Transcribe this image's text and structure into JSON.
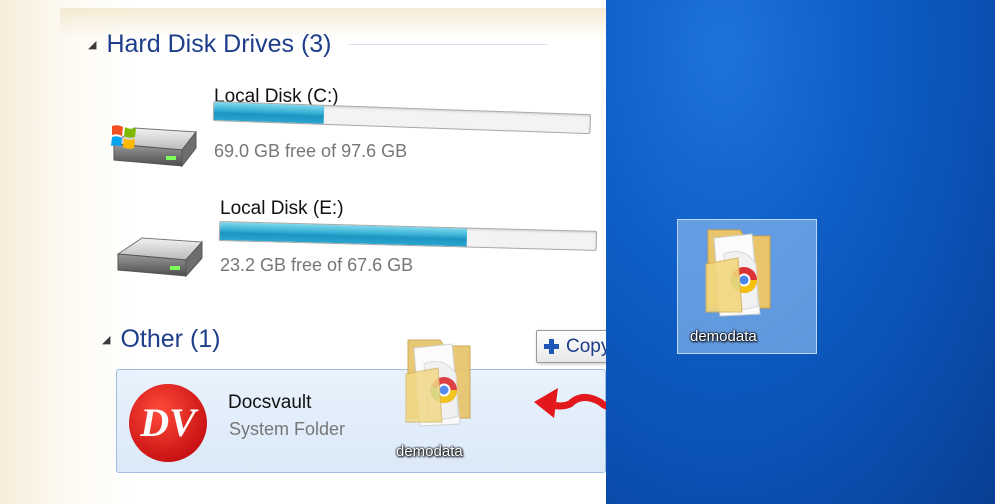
{
  "explorer": {
    "hard_disk_group": {
      "title": "Hard Disk Drives (3)"
    },
    "drives": [
      {
        "name": "Local Disk (C:)",
        "free_text": "69.0 GB free of 97.6 GB",
        "used_fraction": 0.293
      },
      {
        "name": "Local Disk (E:)",
        "free_text": "23.2 GB free of 67.6 GB",
        "used_fraction": 0.657
      }
    ],
    "other_group": {
      "title": "Other (1)"
    },
    "other_item": {
      "name": "Docsvault",
      "subtitle": "System Folder",
      "logo_text": "DV"
    }
  },
  "drag": {
    "folder_label": "demodata",
    "tooltip_label": "Copy"
  },
  "desktop": {
    "folder_label": "demodata"
  },
  "colors": {
    "accent": "#1e3e8a",
    "bar_fill": "#2ba7cf",
    "desktop": "#0f5fc8",
    "arrow": "#e3181c"
  }
}
